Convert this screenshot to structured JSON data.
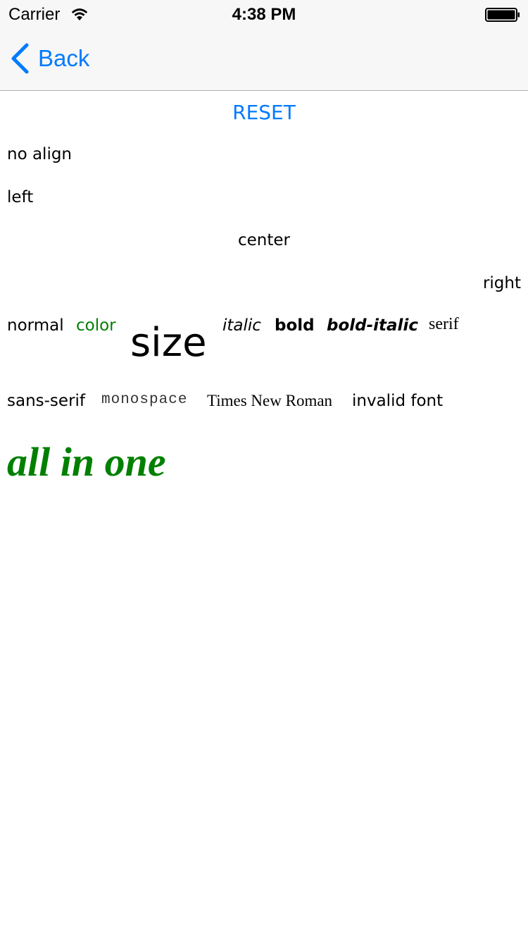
{
  "status_bar": {
    "carrier": "Carrier",
    "time": "4:38 PM",
    "wifi_icon": "wifi-icon",
    "battery_icon": "battery-icon"
  },
  "nav": {
    "back_label": "Back",
    "back_icon": "chevron-left-icon"
  },
  "main": {
    "reset_label": "RESET",
    "align_samples": {
      "no_align": "no align",
      "left": "left",
      "center": "center",
      "right": "right"
    },
    "style_samples": {
      "normal": "normal",
      "color": "color",
      "size": "size",
      "italic": "italic",
      "bold": "bold",
      "bold_italic": "bold-italic",
      "serif": "serif"
    },
    "font_samples": {
      "sans_serif": "sans-serif",
      "monospace": "monospace",
      "times": "Times New Roman",
      "invalid": "invalid font"
    },
    "all_in_one": "all in one"
  },
  "colors": {
    "accent": "#007aff",
    "green": "#008000",
    "bar_bg": "#f7f7f7"
  }
}
